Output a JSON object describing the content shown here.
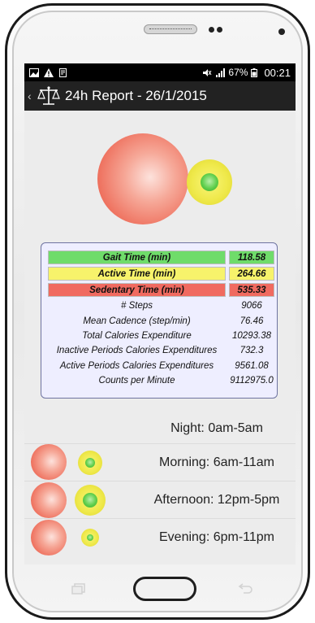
{
  "status_bar": {
    "battery": "67%",
    "time": "00:21"
  },
  "app_bar": {
    "title": "24h Report - 26/1/2015",
    "icons": [
      "back-icon",
      "balance-scale-icon"
    ]
  },
  "colors": {
    "gait": "#6fdc6a",
    "active": "#f7f36b",
    "sedentary": "#f06a60",
    "panel_bg": "#eeeeff"
  },
  "stats": {
    "gait": {
      "label": "Gait Time (min)",
      "value": "118.58"
    },
    "active": {
      "label": "Active Time (min)",
      "value": "264.66"
    },
    "sedentary": {
      "label": "Sedentary Time (min)",
      "value": "535.33"
    },
    "rows": [
      {
        "label": "# Steps",
        "value": "9066"
      },
      {
        "label": "Mean Cadence (step/min)",
        "value": "76.46"
      },
      {
        "label": "Total Calories Expenditure",
        "value": "10293.38"
      },
      {
        "label": "Inactive Periods Calories Expenditures",
        "value": "732.3"
      },
      {
        "label": "Active Periods Calories Expenditures",
        "value": "9561.08"
      },
      {
        "label": "Counts per Minute",
        "value": "9112975.0"
      }
    ]
  },
  "periods": [
    {
      "label": "Night: 0am-5am"
    },
    {
      "label": "Morning: 6am-11am"
    },
    {
      "label": "Afternoon: 12pm-5pm"
    },
    {
      "label": "Evening: 6pm-11pm"
    }
  ]
}
